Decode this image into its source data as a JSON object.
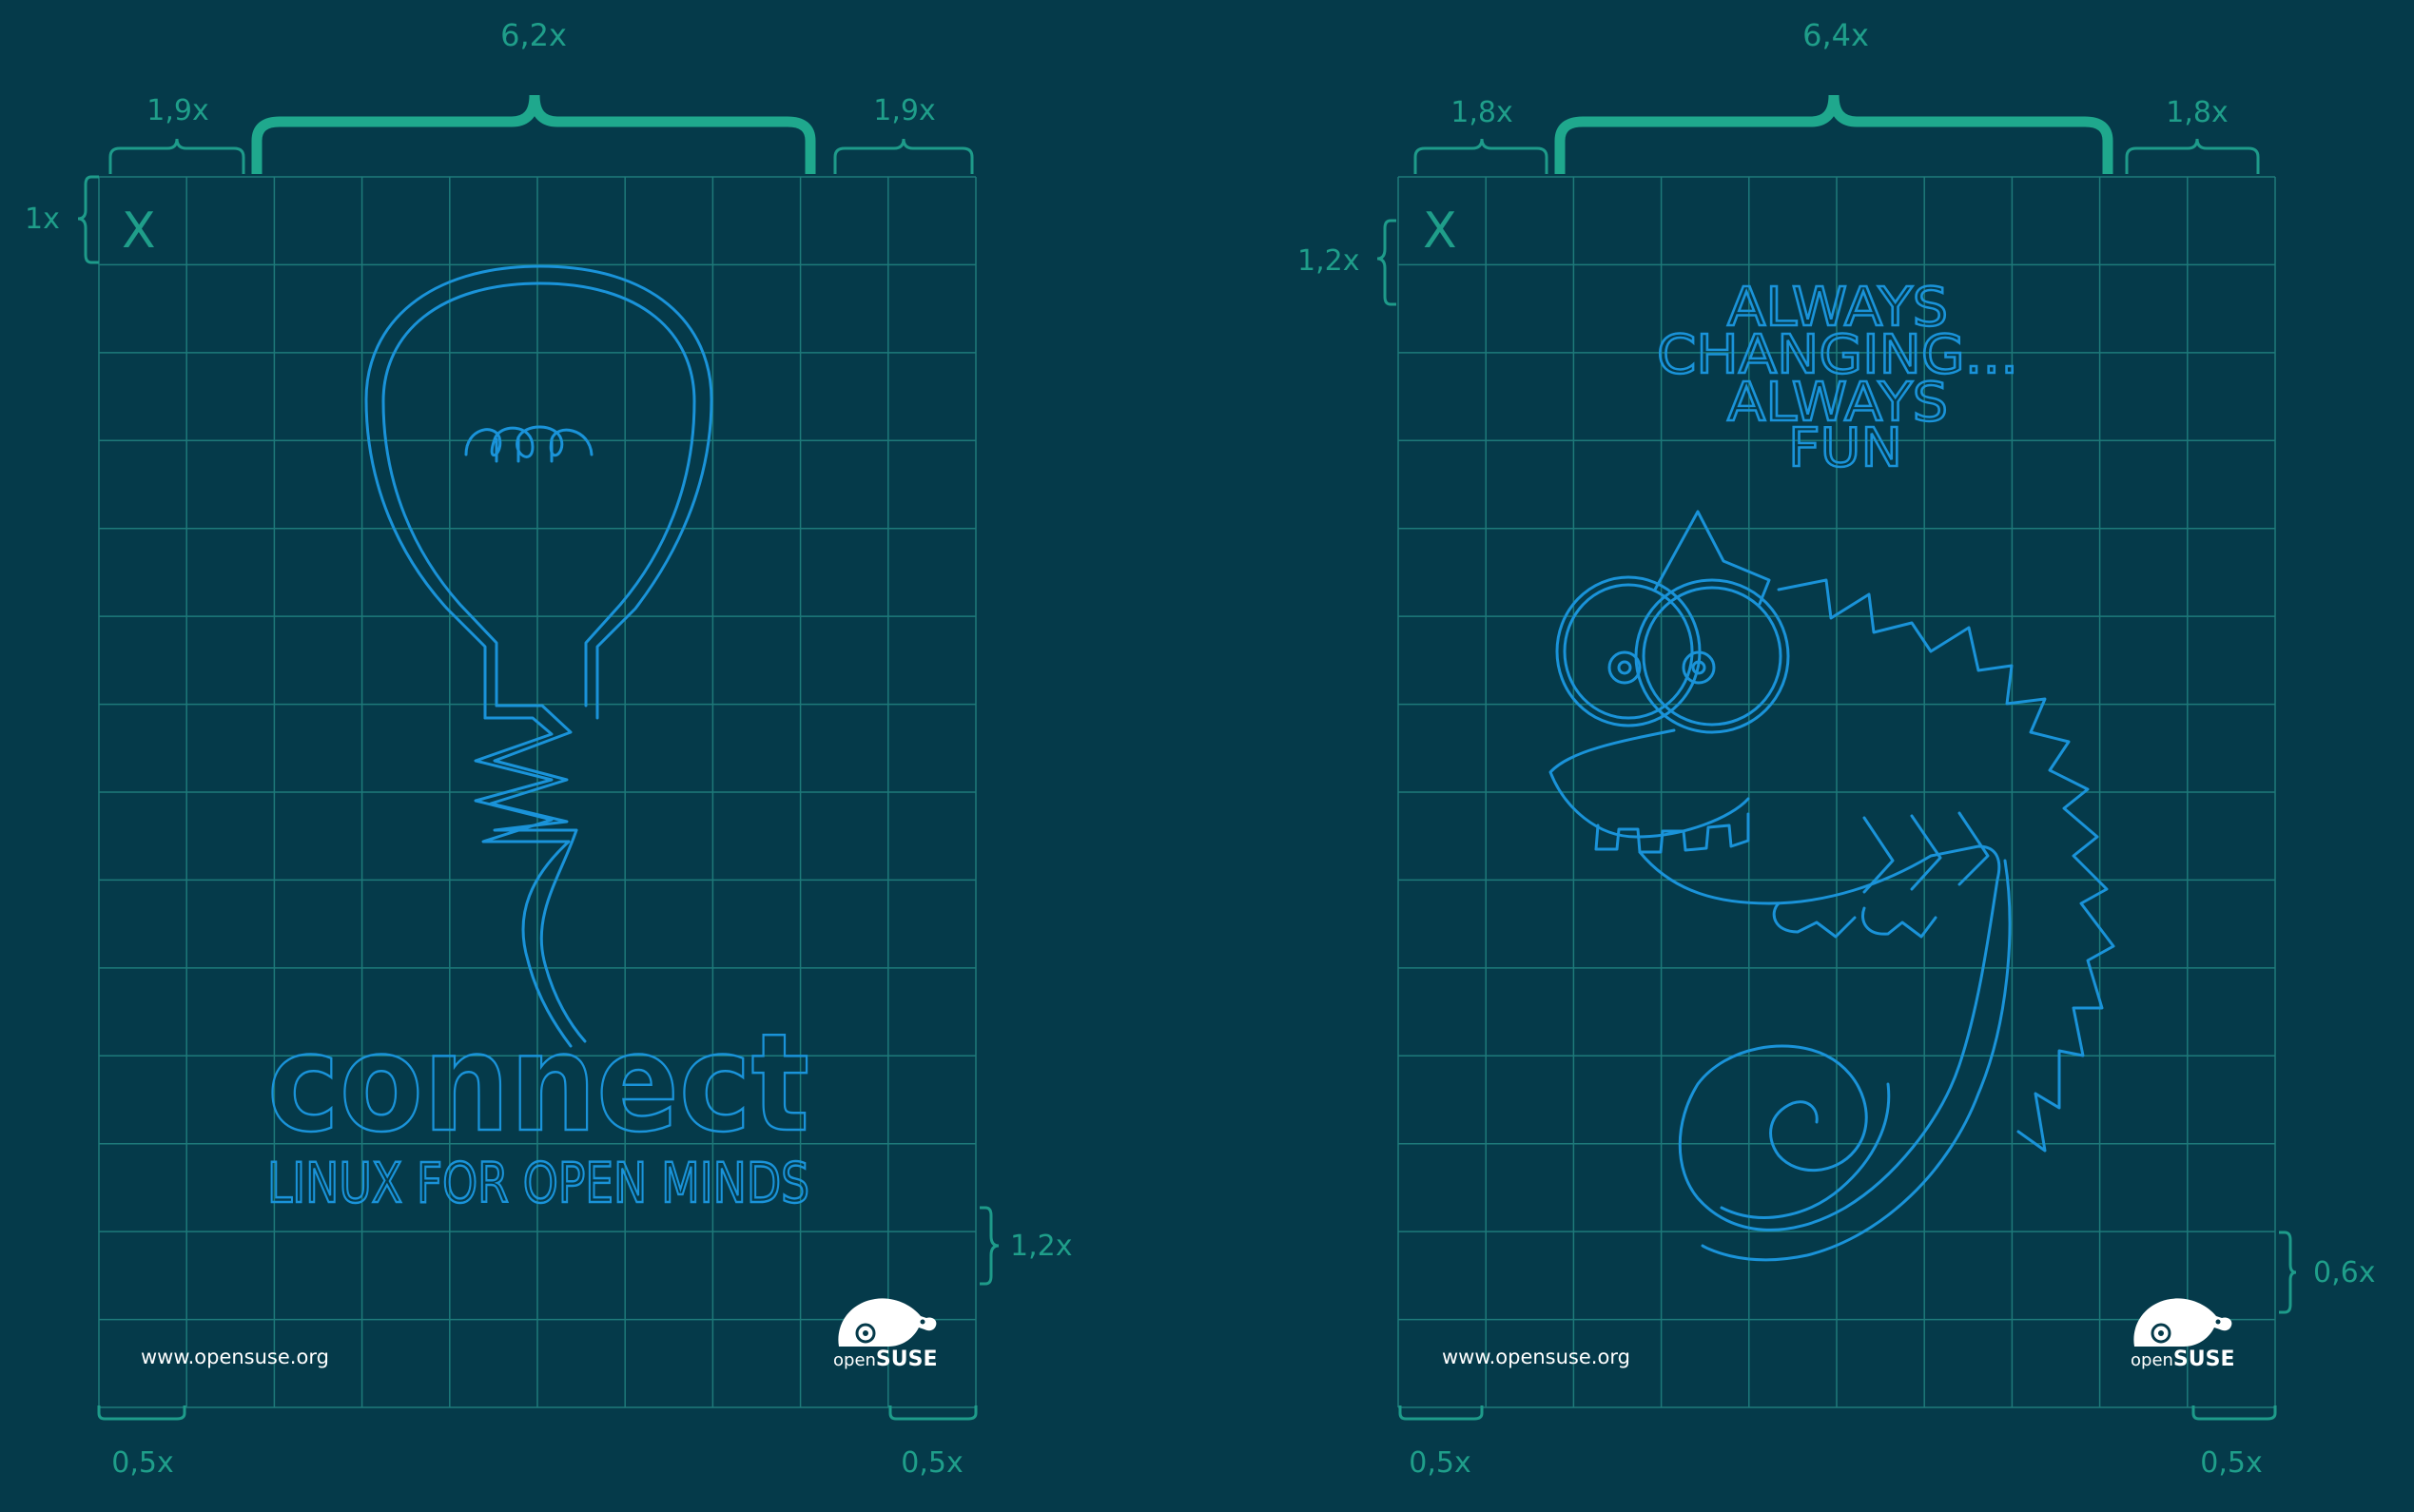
{
  "colors": {
    "background": "#053a4a",
    "grid": "#1e7a7a",
    "brace_big": "#1fa88d",
    "brace_small": "#1e9b8a",
    "dim_text": "#1f9e8a",
    "artwork": "#1a93d9",
    "footer_text": "#ffffff"
  },
  "left_poster": {
    "x_marker": "X",
    "top_left_margin": "1,9x",
    "top_center_width": "6,2x",
    "top_right_margin": "1,9x",
    "side_top_margin": "1x",
    "side_bottom_margin": "1,2x",
    "bottom_left_margin": "0,5x",
    "bottom_right_margin": "0,5x",
    "headline": "connect",
    "tagline": "LINUX FOR OPEN MINDS",
    "url": "www.opensuse.org",
    "logo_text_light": "open",
    "logo_text_bold": "SUSE",
    "logo_icon": "chameleon-logo-icon",
    "artwork_icon": "lightbulb-icon"
  },
  "right_poster": {
    "x_marker": "X",
    "top_left_margin": "1,8x",
    "top_center_width": "6,4x",
    "top_right_margin": "1,8x",
    "side_top_margin": "1,2x",
    "side_bottom_margin": "0,6x",
    "bottom_left_margin": "0,5x",
    "bottom_right_margin": "0,5x",
    "headline_lines": [
      "ALWAYS",
      "CHANGING...",
      "ALWAYS",
      "FUN"
    ],
    "url": "www.opensuse.org",
    "logo_text_light": "open",
    "logo_text_bold": "SUSE",
    "logo_icon": "chameleon-logo-icon",
    "artwork_icon": "chameleon-mascot-icon"
  }
}
